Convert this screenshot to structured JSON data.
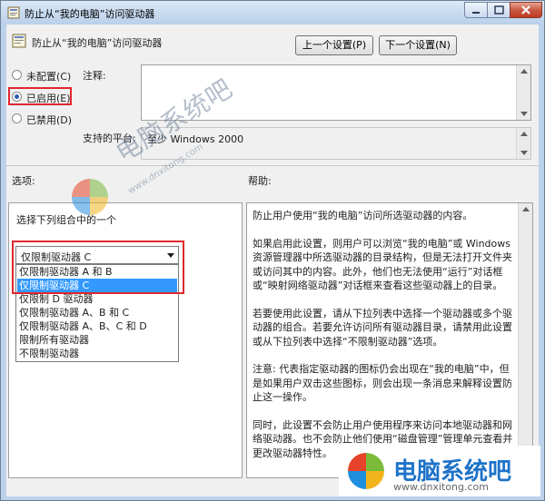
{
  "window": {
    "title": "防止从“我的电脑”访问驱动器"
  },
  "header": {
    "title": "防止从“我的电脑”访问驱动器",
    "prev_button": "上一个设置(P)",
    "next_button": "下一个设置(N)"
  },
  "state": {
    "options": [
      {
        "label": "未配置(C)",
        "selected": false
      },
      {
        "label": "已启用(E)",
        "selected": true
      },
      {
        "label": "已禁用(D)",
        "selected": false
      }
    ]
  },
  "comment": {
    "label": "注释:",
    "value": ""
  },
  "platform": {
    "label": "支持的平台:",
    "value": "至少 Windows 2000"
  },
  "options_section": {
    "label": "选项:",
    "combo_prompt": "选择下列组合中的一个",
    "selected": "仅限制驱动器 C",
    "items": [
      "仅限制驱动器 A 和 B",
      "仅限制驱动器 C",
      "仅限制 D 驱动器",
      "仅限制驱动器 A、B 和 C",
      "仅限制驱动器 A、B、C 和 D",
      "限制所有驱动器",
      "不限制驱动器"
    ],
    "highlighted_index": 1
  },
  "help_section": {
    "label": "帮助:",
    "paragraphs": [
      "防止用户使用“我的电脑”访问所选驱动器的内容。",
      "如果启用此设置，则用户可以浏览“我的电脑”或 Windows 资源管理器中所选驱动器的目录结构，但是无法打开文件夹或访问其中的内容。此外，他们也无法使用“运行”对话框或“映射网络驱动器”对话框来查看这些驱动器上的目录。",
      "若要使用此设置，请从下拉列表中选择一个驱动器或多个驱动器的组合。若要允许访问所有驱动器目录，请禁用此设置或从下拉列表中选择“不限制驱动器”选项。",
      "注意: 代表指定驱动器的图标仍会出现在“我的电脑”中，但是如果用户双击这些图标，则会出现一条消息来解释设置防止这一操作。",
      "同时，此设置不会防止用户使用程序来访问本地驱动器和网络驱动器。也不会防止他们使用“磁盘管理”管理单元查看并更改驱动器特性。"
    ]
  },
  "watermark": {
    "text1": "电脑系统吧",
    "text1_sub": "www.dnxitong.com",
    "text2": "电脑系统吧",
    "text2_sub": "www.dnxitong.com"
  },
  "colors": {
    "accent": "#3399ff",
    "highlight_box": "#e0282e",
    "client_bg": "#f0f0f0"
  }
}
